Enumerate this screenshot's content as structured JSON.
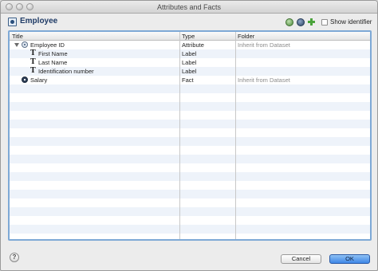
{
  "window": {
    "title": "Attributes and Facts"
  },
  "header": {
    "entity_title": "Employee",
    "show_identifier_label": "Show identifier"
  },
  "table": {
    "columns": {
      "title": "Title",
      "type": "Type",
      "folder": "Folder"
    },
    "rows": [
      {
        "title": "Employee ID",
        "type": "Attribute",
        "folder": "Inherit from Dataset",
        "icon": "attribute-icon",
        "expanded": true
      },
      {
        "title": "First Name",
        "type": "Label",
        "folder": "",
        "icon": "label-icon"
      },
      {
        "title": "Last Name",
        "type": "Label",
        "folder": "",
        "icon": "label-icon"
      },
      {
        "title": "Identification number",
        "type": "Label",
        "folder": "",
        "icon": "label-icon"
      },
      {
        "title": "Salary",
        "type": "Fact",
        "folder": "Inherit from Dataset",
        "icon": "fact-icon"
      }
    ]
  },
  "footer": {
    "help_icon": "help-icon",
    "help_glyph": "?",
    "cancel_label": "Cancel",
    "ok_label": "OK"
  },
  "colors": {
    "accent": "#3d86e6",
    "table_border": "#7ea9d6",
    "title_text": "#1f3b66"
  }
}
